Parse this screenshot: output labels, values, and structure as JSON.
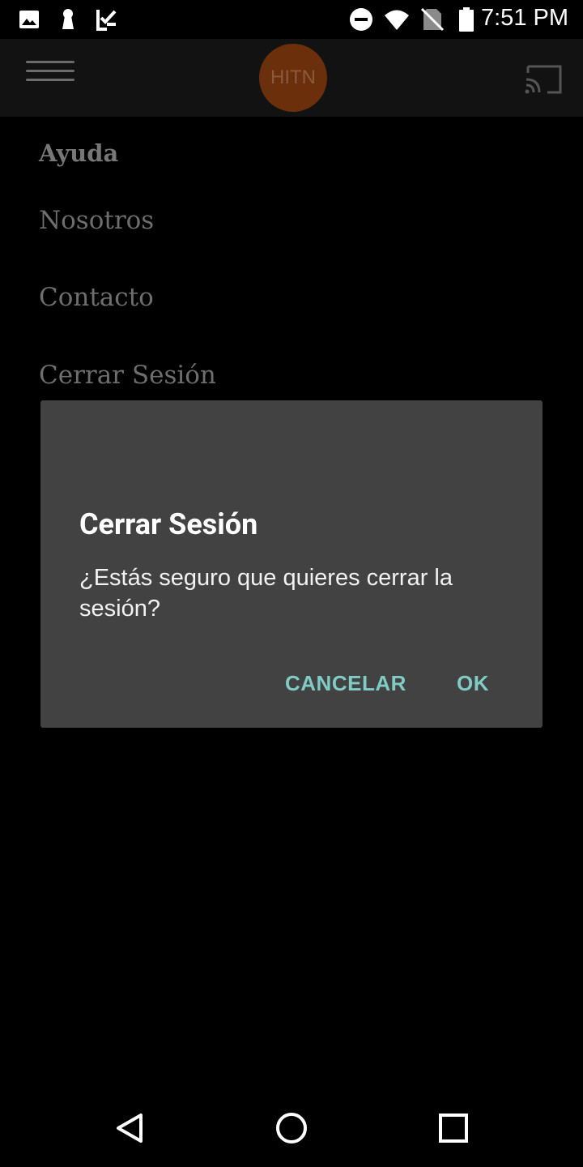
{
  "status_bar": {
    "time": "7:51 PM",
    "icons": [
      "image-icon",
      "keyhole-icon",
      "checklist-icon",
      "do-not-disturb-icon",
      "wifi-icon",
      "no-sim-icon",
      "battery-icon"
    ]
  },
  "app_bar": {
    "logo_text": "HITN",
    "menu_icon": "hamburger-icon",
    "cast_icon": "cast-icon"
  },
  "menu": {
    "items": [
      {
        "label": "Ayuda"
      },
      {
        "label": "Nosotros"
      },
      {
        "label": "Contacto"
      },
      {
        "label": "Cerrar Sesión"
      }
    ]
  },
  "dialog": {
    "title": "Cerrar Sesión",
    "message": "¿Estás seguro que quieres cerrar la sesión?",
    "cancel_label": "CANCELAR",
    "ok_label": "OK"
  },
  "nav_bar": {
    "icons": [
      "back-icon",
      "home-icon",
      "recents-icon"
    ]
  },
  "colors": {
    "dialog_bg": "#424242",
    "accent": "#80cbc4",
    "logo": "#6b2f0c"
  }
}
